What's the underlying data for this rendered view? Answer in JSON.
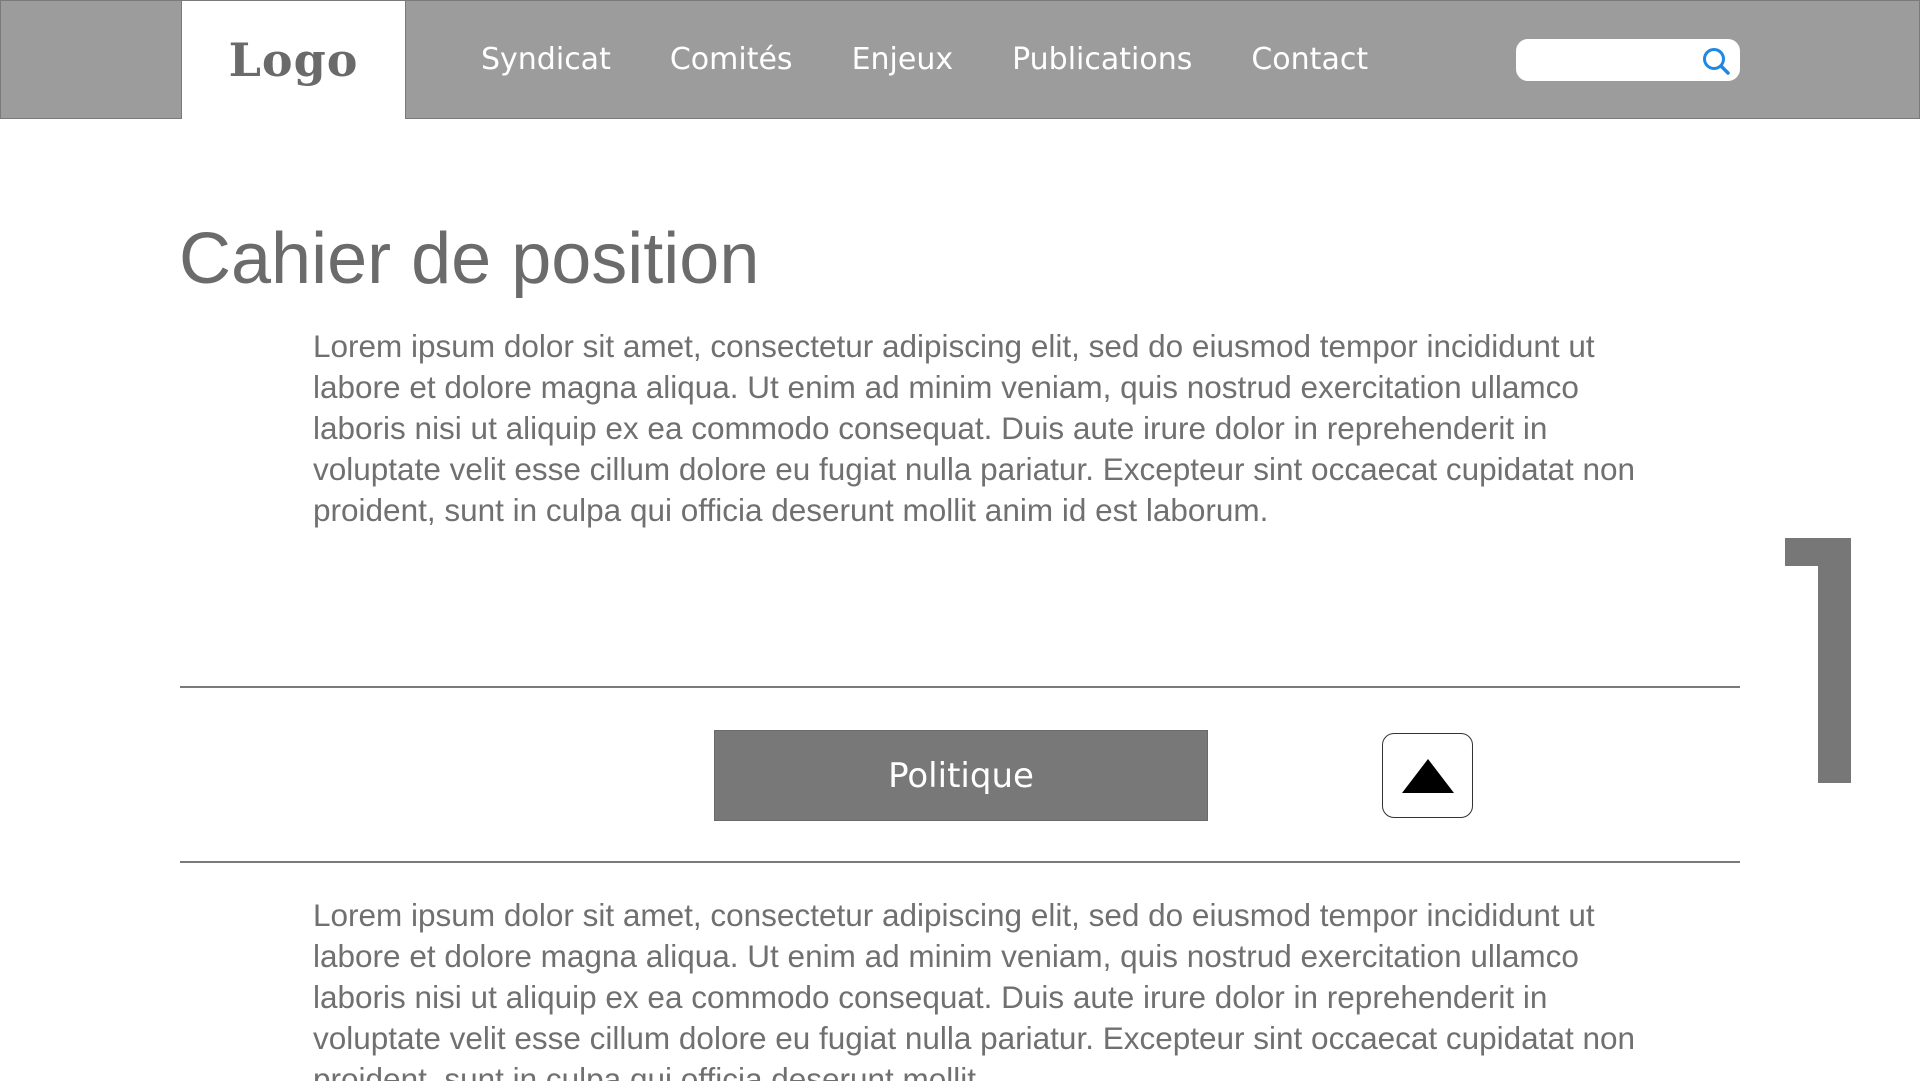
{
  "header": {
    "logo": "Logo",
    "nav": [
      {
        "label": "Syndicat"
      },
      {
        "label": "Comités"
      },
      {
        "label": "Enjeux"
      },
      {
        "label": "Publications"
      },
      {
        "label": "Contact"
      }
    ],
    "search": {
      "value": "",
      "placeholder": ""
    }
  },
  "main": {
    "title": "Cahier de position",
    "paragraph_1": "Lorem ipsum dolor sit amet, consectetur adipiscing elit, sed do eiusmod tempor incididunt ut labore et dolore magna aliqua. Ut enim ad minim veniam, quis nostrud exercitation ullamco laboris nisi ut aliquip ex ea commodo consequat. Duis aute irure dolor in reprehenderit in voluptate velit esse cillum dolore eu fugiat nulla pariatur. Excepteur sint occaecat cupidatat non proident, sunt in culpa qui officia deserunt mollit anim id est laborum.",
    "section_button": "Politique",
    "paragraph_2": "Lorem ipsum dolor sit amet, consectetur adipiscing elit, sed do eiusmod tempor incididunt ut labore et dolore magna aliqua. Ut enim ad minim veniam, quis nostrud exercitation ullamco laboris nisi ut aliquip ex ea commodo consequat. Duis aute irure dolor in reprehenderit in voluptate velit esse cillum dolore eu fugiat nulla pariatur. Excepteur sint occaecat cupidatat non proident, sunt in culpa qui officia deserunt mollit"
  },
  "icons": {
    "search": "search-icon",
    "collapse": "triangle-up-icon",
    "scroll": "scrollbar-handle"
  },
  "colors": {
    "header_bg": "#9c9c9c",
    "button_bg": "#787878",
    "text": "#707070",
    "search_accent": "#1e88e5"
  }
}
